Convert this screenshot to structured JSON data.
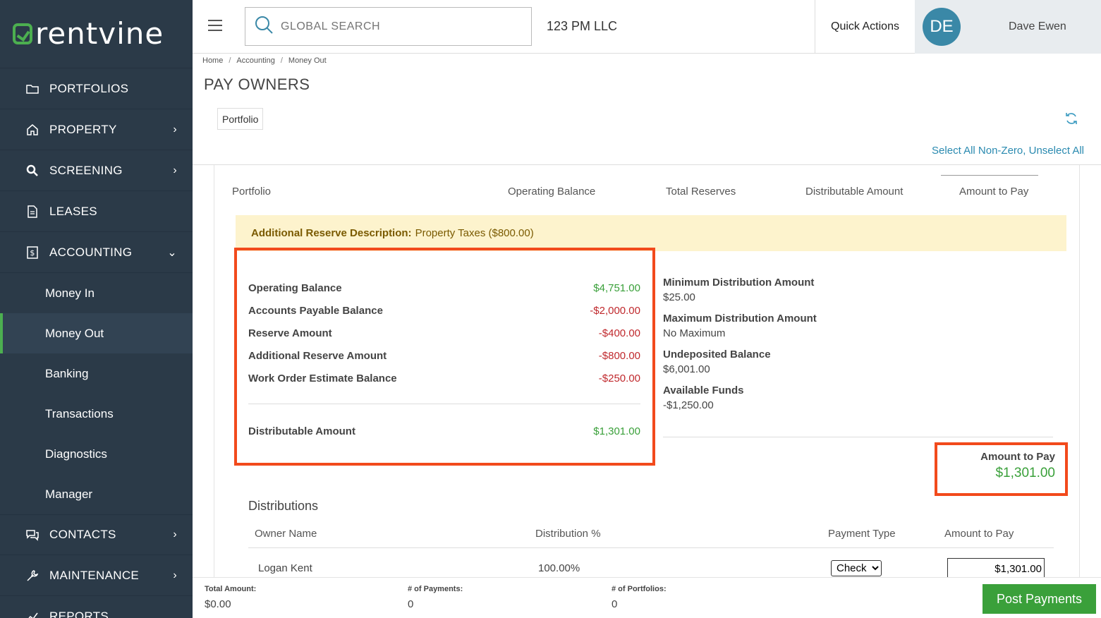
{
  "brand": {
    "name": "rentvine",
    "accent": "#4caf50"
  },
  "sidebar": {
    "items": [
      {
        "label": "PORTFOLIOS",
        "icon": "folder-icon",
        "chevron": ""
      },
      {
        "label": "PROPERTY",
        "icon": "home-icon",
        "chevron": "›"
      },
      {
        "label": "SCREENING",
        "icon": "search-icon",
        "chevron": "›"
      },
      {
        "label": "LEASES",
        "icon": "document-icon",
        "chevron": ""
      },
      {
        "label": "ACCOUNTING",
        "icon": "dollar-icon",
        "chevron": "⌄"
      }
    ],
    "subitems": [
      "Money In",
      "Money Out",
      "Banking",
      "Transactions",
      "Diagnostics",
      "Manager"
    ],
    "lower_items": [
      {
        "label": "CONTACTS",
        "icon": "chat-icon",
        "chevron": "›"
      },
      {
        "label": "MAINTENANCE",
        "icon": "wrench-icon",
        "chevron": "›"
      },
      {
        "label": "REPORTS",
        "icon": "chart-icon",
        "chevron": ""
      }
    ]
  },
  "topbar": {
    "search_placeholder": "GLOBAL SEARCH",
    "company": "123 PM LLC",
    "quick_actions": "Quick Actions",
    "avatar_initials": "DE",
    "username": "Dave Ewen"
  },
  "breadcrumb": [
    "Home",
    "Accounting",
    "Money Out"
  ],
  "page_title": "PAY OWNERS",
  "filter": {
    "portfolio_label": "Portfolio"
  },
  "select_links": {
    "select_all": "Select All Non-Zero",
    "separator": ",",
    "unselect_all": "Unselect All"
  },
  "table_headers": [
    "Portfolio",
    "Operating Balance",
    "Total Reserves",
    "Distributable Amount",
    "Amount to Pay"
  ],
  "reserve": {
    "label": "Additional Reserve Description:",
    "value": "Property Taxes ($800.00)"
  },
  "balances": [
    {
      "label": "Operating Balance",
      "value": "$4,751.00",
      "tone": "pos"
    },
    {
      "label": "Accounts Payable Balance",
      "value": "-$2,000.00",
      "tone": "neg"
    },
    {
      "label": "Reserve Amount",
      "value": "-$400.00",
      "tone": "neg"
    },
    {
      "label": "Additional Reserve Amount",
      "value": "-$800.00",
      "tone": "neg"
    },
    {
      "label": "Work Order Estimate Balance",
      "value": "-$250.00",
      "tone": "neg"
    }
  ],
  "distributable": {
    "label": "Distributable Amount",
    "value": "$1,301.00"
  },
  "right_info": [
    {
      "label": "Minimum Distribution Amount",
      "value": "$25.00",
      "tone": ""
    },
    {
      "label": "Maximum Distribution Amount",
      "value": "No Maximum",
      "tone": ""
    },
    {
      "label": "Undeposited Balance",
      "value": "$6,001.00",
      "tone": ""
    },
    {
      "label": "Available Funds",
      "value": "-$1,250.00",
      "tone": "neg"
    }
  ],
  "amount_to_pay": {
    "label": "Amount to Pay",
    "value": "$1,301.00"
  },
  "distributions": {
    "title": "Distributions",
    "headers": [
      "Owner Name",
      "Distribution %",
      "Payment Type",
      "Amount to Pay"
    ],
    "rows": [
      {
        "owner": "Logan Kent",
        "percent": "100.00%",
        "payment_type": "Check",
        "amount": "$1,301.00"
      }
    ]
  },
  "footer": {
    "total_label": "Total Amount:",
    "total_value": "$0.00",
    "payments_label": "# of Payments:",
    "payments_value": "0",
    "portfolios_label": "# of Portfolios:",
    "portfolios_value": "0",
    "post_button": "Post Payments"
  }
}
